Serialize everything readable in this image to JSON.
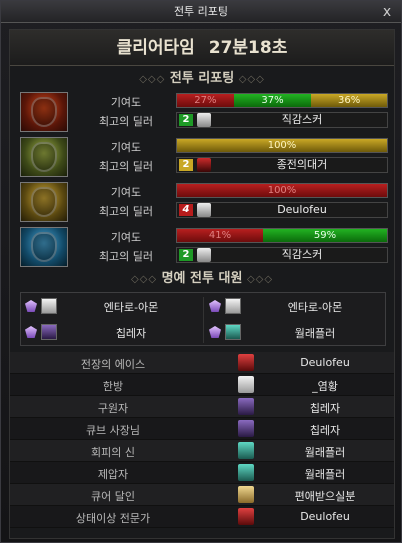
{
  "window": {
    "title": "전투 리포팅",
    "close_label": "x"
  },
  "header": {
    "clear_label": "클리어타임",
    "clear_time": "27분18초"
  },
  "report_section": {
    "title": "전투 리포팅",
    "ornament_left": "◇◇◇",
    "ornament_right": "◇◇◇"
  },
  "labels": {
    "contribution": "기여도",
    "best_dealer": "최고의 딜러"
  },
  "teams": [
    {
      "avatar": "red-helmet-icon",
      "segments": [
        {
          "label": "27%",
          "value": 27,
          "color": "#b81f1f"
        },
        {
          "label": "37%",
          "value": 37,
          "color": "#22b322"
        },
        {
          "label": "36%",
          "value": 36,
          "color": "#c9a825"
        }
      ],
      "dealer_rank": "2",
      "dealer_name": "직감스커"
    },
    {
      "avatar": "green-helmet-icon",
      "segments": [
        {
          "label": "100%",
          "value": 100,
          "color": "#c9a825"
        }
      ],
      "dealer_rank": "2",
      "dealer_name": "종전의대거"
    },
    {
      "avatar": "yellow-helmet-icon",
      "segments": [
        {
          "label": "100%",
          "value": 100,
          "color": "#b81f1f"
        }
      ],
      "dealer_rank": "4",
      "dealer_name": "Deulofeu"
    },
    {
      "avatar": "blue-helmet-icon",
      "segments": [
        {
          "label": "41%",
          "value": 41,
          "color": "#b81f1f"
        },
        {
          "label": "59%",
          "value": 59,
          "color": "#22b322"
        }
      ],
      "dealer_rank": "2",
      "dealer_name": "직감스커"
    }
  ],
  "honor_section": {
    "title": "명예 전투 대원",
    "ornament_left": "◇◇◇",
    "ornament_right": "◇◇◇",
    "members": [
      {
        "name": "엔타로-아몬"
      },
      {
        "name": "엔타로-아몬"
      },
      {
        "name": "칩레자"
      },
      {
        "name": "월래플러"
      }
    ]
  },
  "awards": [
    {
      "title": "전장의 에이스",
      "name": "Deulofeu"
    },
    {
      "title": "한방",
      "name": "_염황"
    },
    {
      "title": "구원자",
      "name": "칩레자"
    },
    {
      "title": "큐브 사장님",
      "name": "칩레자"
    },
    {
      "title": "회피의 신",
      "name": "월래플러"
    },
    {
      "title": "제압자",
      "name": "월래플러"
    },
    {
      "title": "큐어 달인",
      "name": "편애받으실분"
    },
    {
      "title": "상태이상 전문가",
      "name": "Deulofeu"
    }
  ]
}
